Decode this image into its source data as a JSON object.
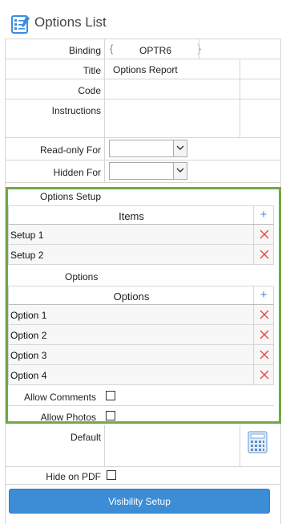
{
  "header": {
    "title": "Options List"
  },
  "fields": {
    "binding": {
      "label": "Binding",
      "value": "OPTR6",
      "open_brace": "{",
      "close_brace": "}"
    },
    "title": {
      "label": "Title",
      "value": "Options Report"
    },
    "code": {
      "label": "Code",
      "value": ""
    },
    "instructions": {
      "label": "Instructions",
      "value": ""
    },
    "readonly_for": {
      "label": "Read-only For",
      "value": ""
    },
    "hidden_for": {
      "label": "Hidden For",
      "value": ""
    }
  },
  "options_setup": {
    "label": "Options Setup",
    "items_header": "Items",
    "add_symbol": "+",
    "items": [
      "Setup 1",
      "Setup 2"
    ]
  },
  "options": {
    "label": "Options",
    "header": "Options",
    "add_symbol": "+",
    "items": [
      "Option 1",
      "Option 2",
      "Option 3",
      "Option 4"
    ]
  },
  "allow_comments": {
    "label": "Allow Comments",
    "checked": false
  },
  "allow_photos": {
    "label": "Allow Photos",
    "checked": false
  },
  "default": {
    "label": "Default",
    "value": ""
  },
  "hide_on_pdf": {
    "label": "Hide on PDF",
    "checked": false
  },
  "visibility_button": {
    "label": "Visibility Setup"
  },
  "colors": {
    "accent": "#3c8cd6",
    "green_border": "#72a845",
    "delete_red": "#e05050",
    "plus_blue": "#3a8de0"
  }
}
